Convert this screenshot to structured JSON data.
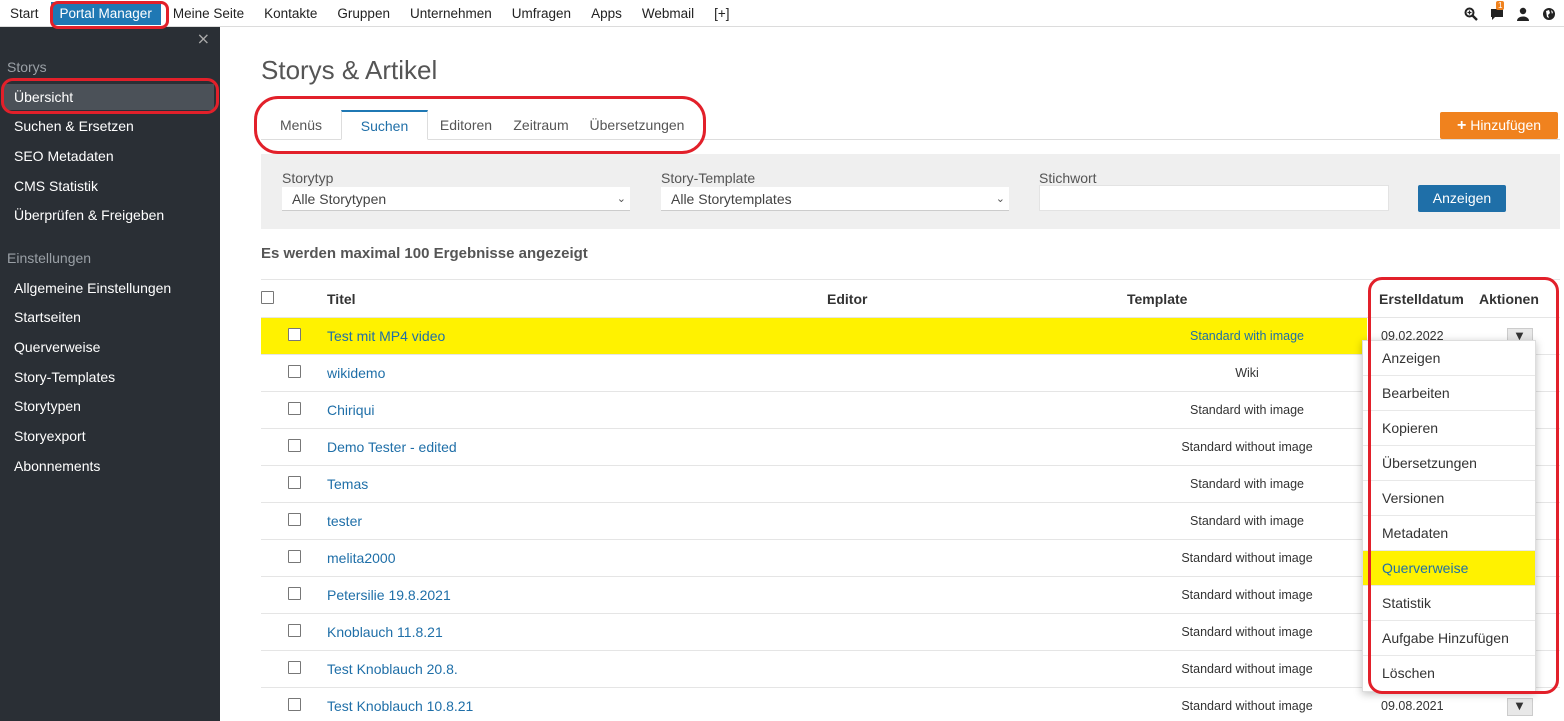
{
  "topnav": {
    "items": [
      "Start",
      "Portal Manager",
      "Meine Seite",
      "Kontakte",
      "Gruppen",
      "Unternehmen",
      "Umfragen",
      "Apps",
      "Webmail",
      "[+]"
    ],
    "notification_count": "1"
  },
  "sidebar": {
    "close": "×",
    "section1": "Storys",
    "items1": [
      "Übersicht",
      "Suchen & Ersetzen",
      "SEO Metadaten",
      "CMS Statistik",
      "Überprüfen & Freigeben"
    ],
    "section2": "Einstellungen",
    "items2": [
      "Allgemeine Einstellungen",
      "Startseiten",
      "Querverweise",
      "Story-Templates",
      "Storytypen",
      "Storyexport",
      "Abonnements"
    ]
  },
  "page": {
    "title": "Storys & Artikel",
    "tabs": [
      "Menüs",
      "Suchen",
      "Editoren",
      "Zeitraum",
      "Übersetzungen"
    ],
    "add_button": "Hinzufügen"
  },
  "filter": {
    "storytyp_label": "Storytyp",
    "storytyp_value": "Alle Storytypen",
    "template_label": "Story-Template",
    "template_value": "Alle Storytemplates",
    "keyword_label": "Stichwort",
    "keyword_value": "",
    "show_button": "Anzeigen"
  },
  "results": {
    "info": "Es werden maximal 100 Ergebnisse angezeigt",
    "columns": [
      "Titel",
      "Editor",
      "Template",
      "Erstelldatum",
      "Aktionen"
    ],
    "rows": [
      {
        "title": "Test mit MP4 video",
        "template": "Standard with image",
        "date": "09.02.2022"
      },
      {
        "title": "wikidemo",
        "template": "Wiki",
        "date": ""
      },
      {
        "title": "Chiriqui",
        "template": "Standard with image",
        "date": ""
      },
      {
        "title": "Demo Tester - edited",
        "template": "Standard without image",
        "date": ""
      },
      {
        "title": "Temas",
        "template": "Standard with image",
        "date": ""
      },
      {
        "title": "tester",
        "template": "Standard with image",
        "date": ""
      },
      {
        "title": "melita2000",
        "template": "Standard without image",
        "date": ""
      },
      {
        "title": "Petersilie 19.8.2021",
        "template": "Standard without image",
        "date": ""
      },
      {
        "title": "Knoblauch 11.8.21",
        "template": "Standard without image",
        "date": ""
      },
      {
        "title": "Test Knoblauch 20.8.",
        "template": "Standard without image",
        "date": ""
      },
      {
        "title": "Test Knoblauch 10.8.21",
        "template": "Standard without image",
        "date": "09.08.2021"
      }
    ]
  },
  "action_menu": {
    "items": [
      "Anzeigen",
      "Bearbeiten",
      "Kopieren",
      "Übersetzungen",
      "Versionen",
      "Metadaten",
      "Querverweise",
      "Statistik",
      "Aufgabe Hinzufügen",
      "Löschen"
    ]
  },
  "colors": {
    "primary": "#1f6fa8",
    "accent": "#f0821e",
    "highlight": "#fff200",
    "annotation": "#e2202a",
    "sidebar": "#2a2f35"
  }
}
